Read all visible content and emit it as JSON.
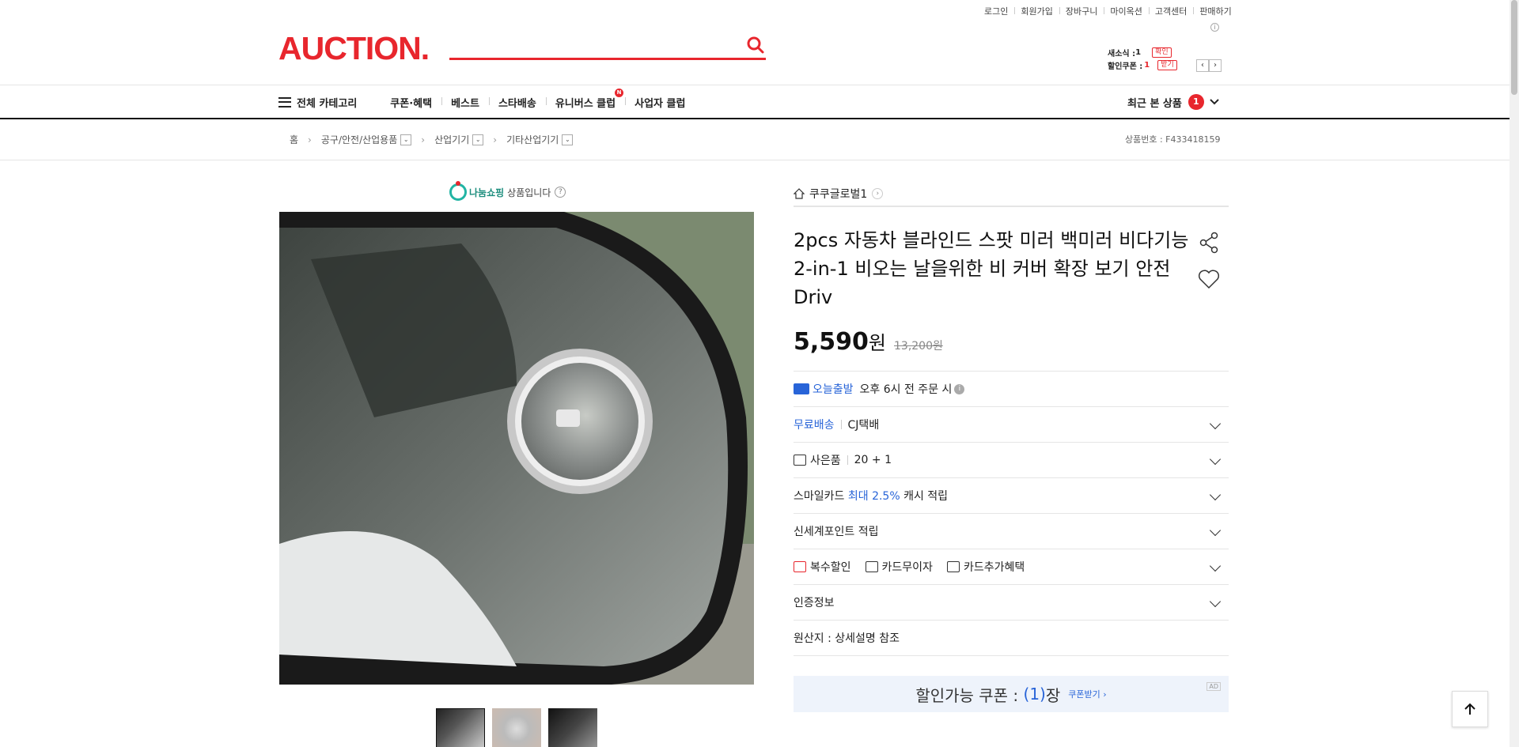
{
  "util_links": [
    "로그인",
    "회원가입",
    "장바구니",
    "마이옥션",
    "고객센터",
    "판매하기"
  ],
  "header": {
    "logo": "AUCTION.",
    "search_placeholder": "",
    "mini": {
      "news_label": "새소식 :",
      "news_count": "1",
      "news_btn": "확인",
      "coupon_label": "할인쿠폰 :",
      "coupon_count": "1",
      "coupon_btn": "받기"
    }
  },
  "gnb": {
    "all_category": "전체 카테고리",
    "items": [
      "쿠폰·혜택",
      "베스트",
      "스타배송",
      "유니버스 클럽",
      "사업자 클럽"
    ],
    "new_badge": "N",
    "recent_label": "최근 본 상품",
    "recent_count": "1"
  },
  "breadcrumb": {
    "items": [
      "홈",
      "공구/안전/산업용품",
      "산업기기",
      "기타산업기기"
    ],
    "product_no": "상품번호 : F433418159"
  },
  "gallery": {
    "nanum_logo": "나눔쇼핑",
    "nanum_text": "상품입니다"
  },
  "product": {
    "shop_name": "쿠쿠글로벌1",
    "title": "2pcs 자동차 블라인드 스팟 미러 백미러 비다기능 2-in-1 비오는 날을위한 비 커버 확장 보기 안전 Driv",
    "price": "5,590",
    "won": "원",
    "original_price": "13,200원",
    "today_ship": "오늘출발",
    "today_ship_desc": "오후 6시 전 주문 시",
    "free_ship": "무료배송",
    "carrier": "CJ택배",
    "gift_label": "사은품",
    "gift_value": "20 + 1",
    "smile_pre": "스마일카드",
    "smile_hl": "최대 2.5%",
    "smile_post": "캐시 적립",
    "shinsegae": "신세계포인트 적립",
    "multi_discount": "복수할인",
    "card_free": "카드무이자",
    "card_extra": "카드추가혜택",
    "cert": "인증정보",
    "origin": "원산지 : 상세설명 참조"
  },
  "coupon": {
    "label": "할인가능 쿠폰 :",
    "count": "(1)",
    "unit": "장",
    "get": "쿠폰받기 ›",
    "ad": "AD"
  },
  "colors": {
    "brand": "#e8262d",
    "accent_blue": "#2864d8"
  }
}
